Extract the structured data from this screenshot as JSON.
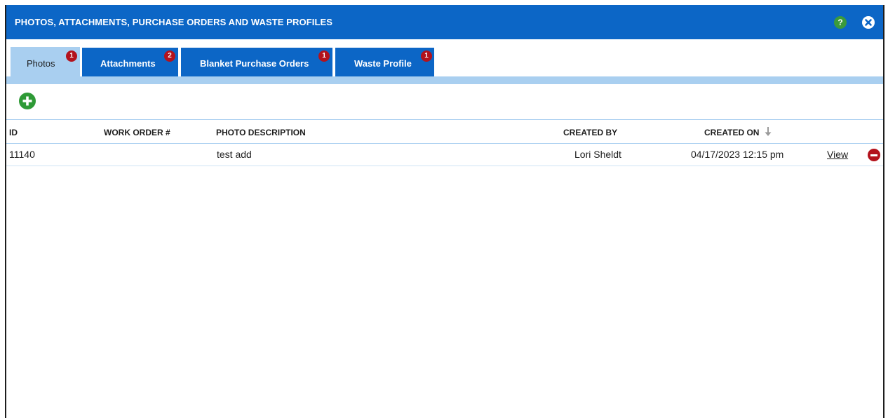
{
  "dialog": {
    "title": "PHOTOS, ATTACHMENTS, PURCHASE ORDERS AND WASTE PROFILES",
    "help_label": "?"
  },
  "tabs": [
    {
      "label": "Photos",
      "badge": "1",
      "active": true
    },
    {
      "label": "Attachments",
      "badge": "2",
      "active": false
    },
    {
      "label": "Blanket Purchase Orders",
      "badge": "1",
      "active": false
    },
    {
      "label": "Waste Profile",
      "badge": "1",
      "active": false
    }
  ],
  "table": {
    "columns": {
      "id": "ID",
      "work_order": "WORK ORDER #",
      "photo_description": "PHOTO DESCRIPTION",
      "created_by": "CREATED BY",
      "created_on": "CREATED ON"
    },
    "sort": {
      "column": "created_on",
      "direction": "descending"
    },
    "rows": [
      {
        "id": "11140",
        "work_order": "",
        "photo_description": "test add",
        "created_by": "Lori Sheldt",
        "created_on": "04/17/2023 12:15 pm",
        "action_label": "View"
      }
    ]
  },
  "colors": {
    "titlebar": "#0c66c6",
    "active_tab": "#a9cff0",
    "badge": "#b3121c",
    "add_button": "#2e9a36",
    "help_button": "#3b9a3b",
    "delete_button": "#b3121c"
  },
  "icons": {
    "help": "help-icon",
    "close": "close-icon",
    "add": "add-icon",
    "sort": "sort-down-arrow-icon",
    "delete": "delete-icon"
  }
}
